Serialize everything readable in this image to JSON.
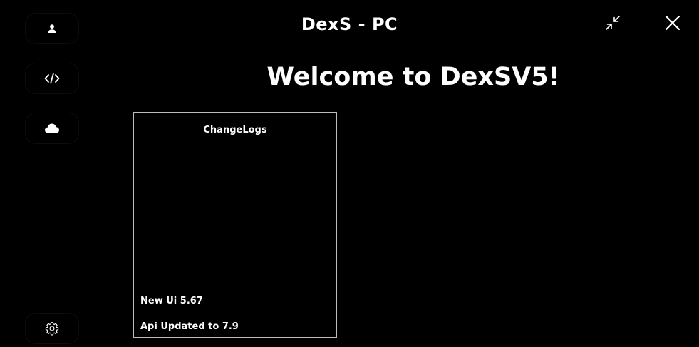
{
  "window": {
    "title": "DexS - PC"
  },
  "sidebar": {
    "items": [
      {
        "icon": "user-icon"
      },
      {
        "icon": "code-icon"
      },
      {
        "icon": "cloud-icon"
      },
      {
        "icon": "gear-icon"
      }
    ]
  },
  "titlebar_buttons": [
    {
      "icon": "minimize-icon"
    },
    {
      "icon": "close-icon"
    }
  ],
  "main": {
    "welcome": "Welcome to DexSV5!",
    "changelog": {
      "title": "ChangeLogs",
      "entries": [
        "New Ui 5.67",
        "Api Updated to 7.9"
      ]
    }
  },
  "colors": {
    "background": "#000000",
    "text": "#ffffff",
    "panel_border": "#bdbdbd"
  }
}
